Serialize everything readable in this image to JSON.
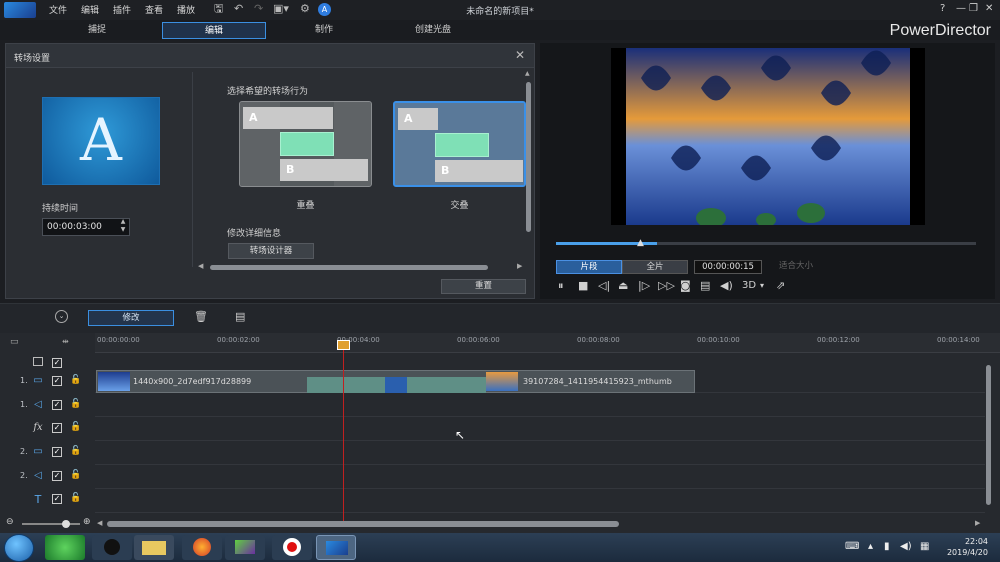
{
  "menu": [
    "文件",
    "编辑",
    "插件",
    "查看",
    "播放"
  ],
  "window_title": "未命名的新项目*",
  "window_controls": {
    "help": "?",
    "minimize": "—",
    "restore": "❐",
    "close": "✕"
  },
  "modes": [
    "捕捉",
    "编辑",
    "制作",
    "创建光盘"
  ],
  "active_mode": "编辑",
  "brand": "PowerDirector",
  "transition_panel": {
    "title": "转场设置",
    "duration_label": "持续时间",
    "duration_value": "00:00:03:00",
    "behavior_label": "选择希望的转场行为",
    "options": [
      {
        "label": "重叠",
        "a": "A",
        "b": "B",
        "selected": false
      },
      {
        "label": "交叠",
        "a": "A",
        "b": "B",
        "selected": true
      }
    ],
    "detail_label": "修改详细信息",
    "designer_button": "转场设计器",
    "apply_button": "重置",
    "thumb_letter": "A"
  },
  "preview": {
    "clip_button": "片段",
    "full_button": "全片",
    "timecode": "00:00:00:15",
    "fit_label": "适合大小",
    "mode_3d": "3D",
    "progress": 0.24
  },
  "toolbar": {
    "modify_button": "修改"
  },
  "timeline": {
    "ticks": [
      "00:00:00:00",
      "00:00:02:00",
      "00:00:04:00",
      "00:00:06:00",
      "00:00:08:00",
      "00:00:10:00",
      "00:00:12:00",
      "00:00:14:00"
    ],
    "tracks": [
      {
        "num": "1.",
        "icon": "video-icon",
        "glyph": "▭"
      },
      {
        "num": "1.",
        "icon": "audio-icon",
        "glyph": "◁"
      },
      {
        "num": "",
        "icon": "fx-icon",
        "glyph": "fx"
      },
      {
        "num": "2.",
        "icon": "video-icon",
        "glyph": "▭"
      },
      {
        "num": "2.",
        "icon": "audio-icon",
        "glyph": "◁"
      },
      {
        "num": "",
        "icon": "title-icon",
        "glyph": "T"
      }
    ],
    "clip1_name": "1440x900_2d7edf917d28899",
    "clip2_name": "39107284_1411954415923_mthumb"
  },
  "taskbar": {
    "time": "22:04",
    "date": "2019/4/20"
  }
}
